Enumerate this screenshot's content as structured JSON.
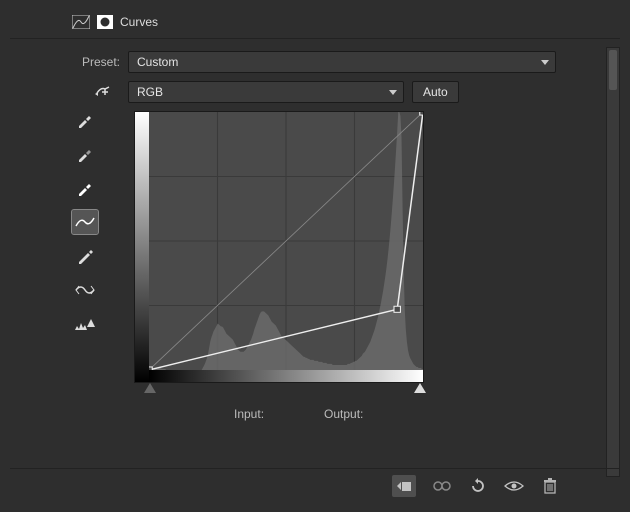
{
  "title": "Curves",
  "preset": {
    "label": "Preset:",
    "value": "Custom"
  },
  "channel": {
    "value": "RGB"
  },
  "auto_label": "Auto",
  "input_label": "Input:",
  "output_label": "Output:",
  "chart_data": {
    "type": "curve_editor",
    "xlim": [
      0,
      255
    ],
    "ylim": [
      0,
      255
    ],
    "grid_divisions": 4,
    "identity_line": true,
    "control_points": [
      {
        "x": 0,
        "y": 0
      },
      {
        "x": 231,
        "y": 60
      },
      {
        "x": 255,
        "y": 255
      }
    ],
    "range_sliders": {
      "black": 0,
      "white": 255
    },
    "histogram": {
      "channel": "luminosity",
      "values": [
        0,
        0,
        0,
        0,
        0,
        1,
        1,
        1,
        1,
        2,
        2,
        2,
        1,
        1,
        1,
        1,
        0,
        0,
        0,
        0,
        0,
        0,
        0,
        0,
        0,
        0,
        0,
        0,
        0,
        0,
        0,
        0,
        0,
        0,
        0,
        0,
        0,
        0,
        0,
        0,
        0,
        0,
        0,
        0,
        0,
        0,
        0,
        0,
        0,
        0,
        2,
        4,
        6,
        9,
        12,
        16,
        22,
        28,
        32,
        35,
        38,
        40,
        42,
        44,
        46,
        45,
        44,
        43,
        43,
        42,
        40,
        38,
        36,
        35,
        34,
        33,
        32,
        31,
        30,
        28,
        26,
        24,
        22,
        20,
        19,
        18,
        18,
        18,
        18,
        19,
        20,
        22,
        24,
        26,
        28,
        30,
        33,
        36,
        40,
        43,
        46,
        49,
        52,
        55,
        57,
        58,
        58,
        58,
        57,
        56,
        55,
        54,
        52,
        50,
        48,
        47,
        46,
        45,
        44,
        42,
        40,
        38,
        36,
        34,
        33,
        32,
        31,
        30,
        29,
        28,
        27,
        26,
        25,
        24,
        23,
        22,
        21,
        20,
        19,
        18,
        17,
        16,
        15,
        14,
        13,
        13,
        12,
        12,
        11,
        11,
        10,
        10,
        10,
        10,
        9,
        9,
        9,
        9,
        8,
        8,
        8,
        8,
        7,
        7,
        7,
        7,
        6,
        6,
        6,
        6,
        6,
        5,
        5,
        5,
        5,
        5,
        5,
        5,
        5,
        5,
        5,
        5,
        5,
        5,
        5,
        6,
        6,
        6,
        7,
        7,
        8,
        8,
        9,
        9,
        10,
        11,
        12,
        13,
        14,
        16,
        17,
        18,
        20,
        22,
        24,
        26,
        28,
        31,
        34,
        37,
        40,
        44,
        48,
        52,
        57,
        62,
        67,
        73,
        79,
        86,
        93,
        101,
        110,
        120,
        131,
        143,
        156,
        170,
        185,
        201,
        218,
        236,
        255,
        255,
        251,
        230,
        160,
        100,
        60,
        40,
        28,
        20,
        15,
        12,
        10,
        8,
        6,
        5,
        4,
        3,
        3,
        2,
        2,
        2,
        1,
        1
      ]
    }
  }
}
